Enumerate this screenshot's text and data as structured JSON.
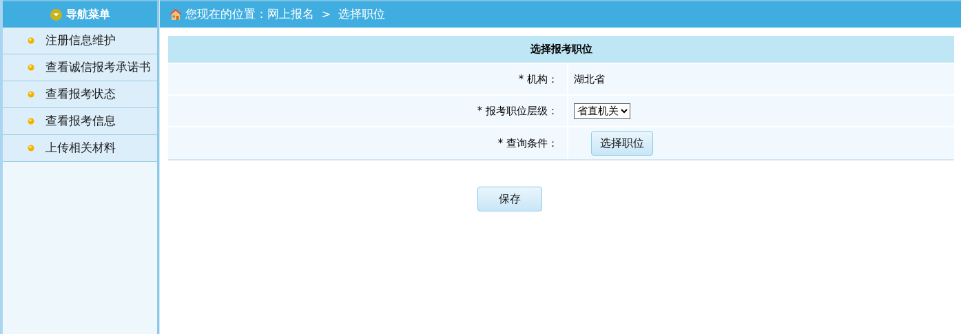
{
  "sidebar": {
    "title": "导航菜单",
    "items": [
      {
        "label": "注册信息维护"
      },
      {
        "label": "查看诚信报考承诺书"
      },
      {
        "label": "查看报考状态"
      },
      {
        "label": "查看报考信息"
      },
      {
        "label": "上传相关材料"
      }
    ]
  },
  "breadcrumb": "您现在的位置：网上报名  >  选择职位",
  "form": {
    "title": "选择报考职位",
    "rows": [
      {
        "kind": "text",
        "label": "* 机构：",
        "value": "湖北省"
      },
      {
        "kind": "select",
        "label": "* 报考职位层级：",
        "value": "省直机关"
      },
      {
        "kind": "button",
        "label": "* 查询条件：",
        "value": "选择职位"
      }
    ]
  },
  "buttons": [
    "保存"
  ]
}
